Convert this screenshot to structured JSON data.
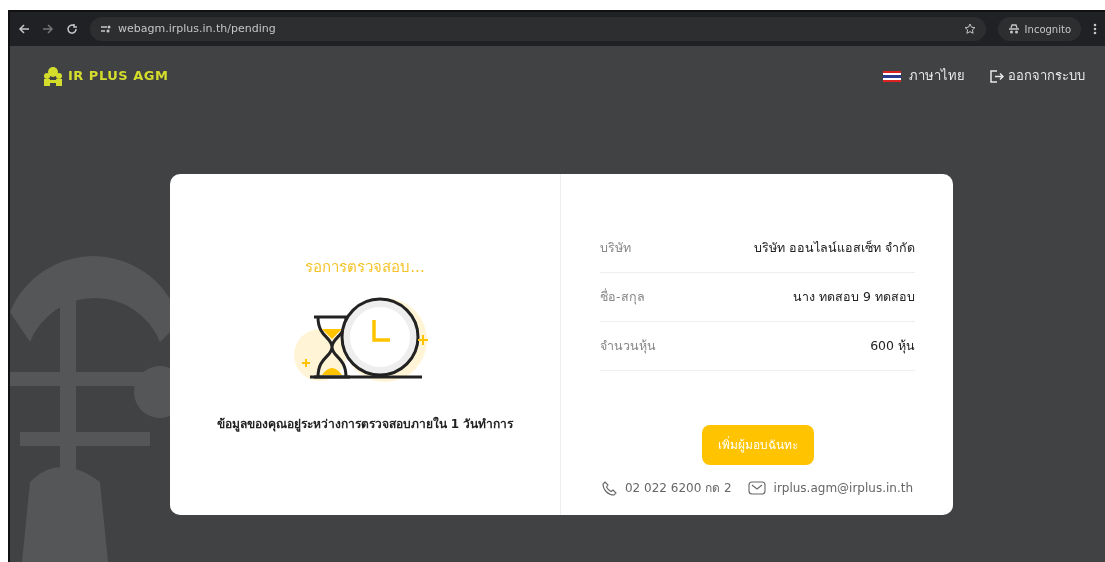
{
  "browser": {
    "url": "webagm.irplus.in.th/pending",
    "profile": "Incognito"
  },
  "header": {
    "logo": "IR PLUS AGM",
    "language": "ภาษาไทย",
    "logout": "ออกจากระบบ"
  },
  "status": {
    "title": "รอการตรวจสอบ...",
    "message": "ข้อมูลของคุณอยู่ระหว่างการตรวจสอบภายใน 1 วันทำการ"
  },
  "details": [
    {
      "label": "บริษัท",
      "value": "บริษัท ออนไลน์แอสเซ็ท จำกัด"
    },
    {
      "label": "ชื่อ-สกุล",
      "value": "นาง ทดสอบ 9 ทดสอบ"
    },
    {
      "label": "จำนวนหุ้น",
      "value": "600 หุ้น"
    }
  ],
  "button": "เพิ่มผู้มอบฉันทะ",
  "contact": {
    "phone": "02 022 6200 กด 2",
    "email": "irplus.agm@irplus.in.th"
  }
}
